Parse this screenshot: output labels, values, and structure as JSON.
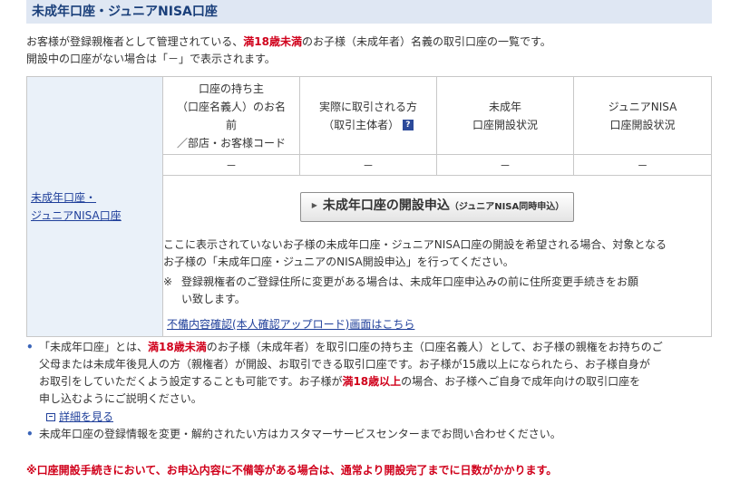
{
  "section_title": "未成年口座・ジュニアNISA口座",
  "intro": {
    "line1_a": "お客様が登録親権者として管理されている、",
    "line1_red": "満18歳未満",
    "line1_b": "のお子様（未成年者）名義の取引口座の一覧です。",
    "line2": "開設中の口座がない場合は「－」で表示されます。"
  },
  "table": {
    "row_label_line1": "未成年口座・",
    "row_label_line2": "ジュニアNISA口座",
    "headers": [
      {
        "l1": "口座の持ち主",
        "l2": "（口座名義人）のお名",
        "l3": "前",
        "l4": "／部店・お客様コード"
      },
      {
        "l1": "実際に取引される方",
        "l2": "（取引主体者）"
      },
      {
        "l1": "未成年",
        "l2": "口座開設状況"
      },
      {
        "l1": "ジュニアNISA",
        "l2": "口座開設状況"
      }
    ],
    "values": [
      "－",
      "－",
      "－",
      "－"
    ],
    "help_icon_glyph": "?"
  },
  "apply_button": {
    "main": "未成年口座の開設申込",
    "sub": "（ジュニアNISA同時申込）"
  },
  "body_text": {
    "line1": "ここに表示されていないお子様の未成年口座・ジュニアNISA口座の開設を希望される場合、対象となる",
    "line2": "お子様の「未成年口座・ジュニアのNISA開設申込」を行ってください。",
    "note_mark": "※",
    "note_line1": "登録親権者のご登録住所に変更がある場合は、未成年口座申込みの前に住所変更手続きをお願",
    "note_line2": "い致します。",
    "doc_link": "不備内容確認(本人確認アップロード)画面はこちら"
  },
  "bullets": {
    "b1_l1_a": "「未成年口座」とは、",
    "b1_l1_red": "満18歳未満",
    "b1_l1_b": "のお子様（未成年者）を取引口座の持ち主（口座名義人）として、お子様の親権をお持ちのご",
    "b1_l2": "父母または未成年後見人の方（親権者）が開設、お取引できる取引口座です。お子様が15歳以上になられたら、お子様自身が",
    "b1_l3_a": "お取引をしていただくよう設定することも可能です。お子様が",
    "b1_l3_red": "満18歳以上",
    "b1_l3_b": "の場合、お子様へご自身で成年向けの取引口座を",
    "b1_l4": "申し込むようにご説明ください。",
    "detail_link": "詳細を見る",
    "b2": "未成年口座の登録情報を変更・解約されたい方はカスタマーサービスセンターまでお問い合わせください。"
  },
  "warning": "※口座開設手続きにおいて、お申込内容に不備等がある場合は、通常より開設完了までに日数がかかります。",
  "colors": {
    "accent_red": "#d0001b",
    "link_blue": "#1f3f9a",
    "header_bg": "#dfe7f3"
  }
}
